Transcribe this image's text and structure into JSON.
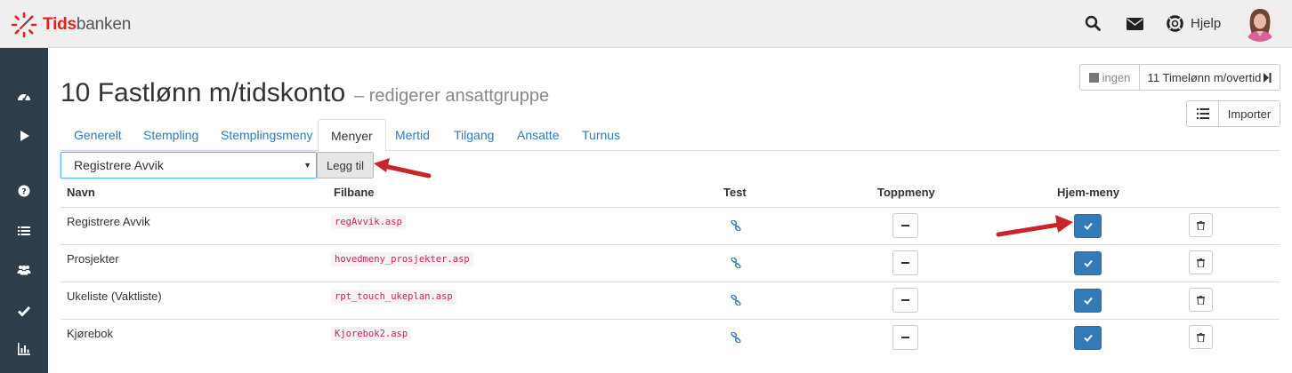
{
  "header": {
    "logo_part1": "Tids",
    "logo_part2": "banken",
    "help_label": "Hjelp",
    "icons": [
      "search-icon",
      "envelope-icon",
      "lifebuoy-icon"
    ]
  },
  "sidebar": {
    "items": [
      {
        "icon": "dashboard-icon"
      },
      {
        "icon": "play-icon"
      },
      {
        "icon": "question-icon"
      },
      {
        "icon": "list-icon"
      },
      {
        "icon": "users-icon"
      },
      {
        "icon": "check-icon"
      },
      {
        "icon": "bar-chart-icon"
      }
    ]
  },
  "page": {
    "title": "10 Fastlønn m/tidskonto",
    "subtitle": "– redigerer ansattgruppe"
  },
  "nav_buttons": {
    "prev_label": "ingen",
    "next_label": "11 Timelønn m/overtid",
    "import_label": "Importer"
  },
  "tabs": [
    {
      "label": "Generelt"
    },
    {
      "label": "Stempling"
    },
    {
      "label": "Stemplingsmeny"
    },
    {
      "label": "Menyer",
      "active": true
    },
    {
      "label": "Mertid"
    },
    {
      "label": "Tilgang"
    },
    {
      "label": "Ansatte"
    },
    {
      "label": "Turnus"
    }
  ],
  "menu_select": {
    "value": "Registrere Avvik",
    "add_label": "Legg til"
  },
  "table": {
    "headers": {
      "name": "Navn",
      "path": "Filbane",
      "test": "Test",
      "top_menu": "Toppmeny",
      "home_menu": "Hjem-meny"
    },
    "rows": [
      {
        "name": "Registrere Avvik",
        "path": "regAvvik.asp",
        "top_menu": false,
        "home_menu": true
      },
      {
        "name": "Prosjekter",
        "path": "hovedmeny_prosjekter.asp",
        "top_menu": false,
        "home_menu": true
      },
      {
        "name": "Ukeliste (Vaktliste)",
        "path": "rpt_touch_ukeplan.asp",
        "top_menu": false,
        "home_menu": true
      },
      {
        "name": "Kjørebok",
        "path": "Kjorebok2.asp",
        "top_menu": false,
        "home_menu": true
      }
    ]
  },
  "colors": {
    "brand_red": "#e2231a",
    "sidebar_bg": "#2d3e4a",
    "link_blue": "#337ab7",
    "primary_button": "#337ab7",
    "code_text": "#c7254e",
    "annotation_arrow": "#c8262c"
  }
}
